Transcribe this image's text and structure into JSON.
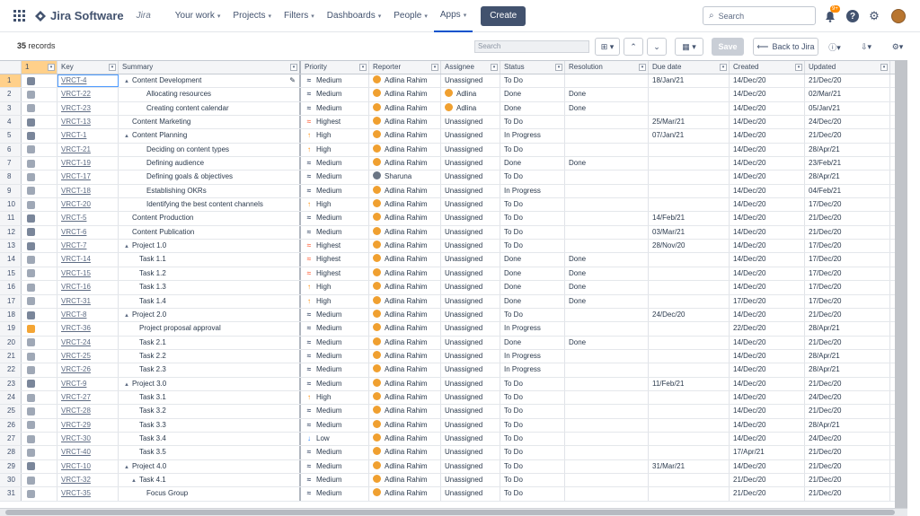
{
  "nav": {
    "app_name": "Jira Software",
    "sub": "Jira",
    "menu": [
      {
        "label": "Your work",
        "dropdown": true
      },
      {
        "label": "Projects",
        "dropdown": true
      },
      {
        "label": "Filters",
        "dropdown": true
      },
      {
        "label": "Dashboards",
        "dropdown": true
      },
      {
        "label": "People",
        "dropdown": true
      },
      {
        "label": "Apps",
        "dropdown": true,
        "active": true
      }
    ],
    "create": "Create",
    "search_placeholder": "Search",
    "notification_count": "9+"
  },
  "toolbar": {
    "records_count": "35",
    "records_label": "records",
    "search_placeholder": "Search",
    "save": "Save",
    "back": "Back to Jira"
  },
  "columns": [
    "",
    "Key",
    "Summary",
    "Priority",
    "Reporter",
    "Assignee",
    "Status",
    "Resolution",
    "Due date",
    "Created",
    "Updated"
  ],
  "rows": [
    {
      "n": "1",
      "type": "epic",
      "key": "VRCT-4",
      "indent": 0,
      "tri": true,
      "summary": "Content Development",
      "pri": "Medium",
      "reporter": "Adlina Rahim",
      "assignee": "Unassigned",
      "status": "To Do",
      "resolution": "",
      "due": "18/Jan/21",
      "created": "14/Dec/20",
      "updated": "21/Dec/20"
    },
    {
      "n": "2",
      "type": "task",
      "key": "VRCT-22",
      "indent": 2,
      "tri": false,
      "summary": "Allocating resources",
      "pri": "Medium",
      "reporter": "Adlina Rahim",
      "assignee": "Adlina",
      "assignee_av": true,
      "status": "Done",
      "resolution": "Done",
      "due": "",
      "created": "14/Dec/20",
      "updated": "02/Mar/21"
    },
    {
      "n": "3",
      "type": "task",
      "key": "VRCT-23",
      "indent": 2,
      "tri": false,
      "summary": "Creating content calendar",
      "pri": "Medium",
      "reporter": "Adlina Rahim",
      "assignee": "Adlina",
      "assignee_av": true,
      "status": "Done",
      "resolution": "Done",
      "due": "",
      "created": "14/Dec/20",
      "updated": "05/Jan/21"
    },
    {
      "n": "4",
      "type": "epic",
      "key": "VRCT-13",
      "indent": 0,
      "tri": false,
      "summary": "Content Marketing",
      "pri": "Highest",
      "reporter": "Adlina Rahim",
      "assignee": "Unassigned",
      "status": "To Do",
      "resolution": "",
      "due": "25/Mar/21",
      "created": "14/Dec/20",
      "updated": "24/Dec/20"
    },
    {
      "n": "5",
      "type": "epic",
      "key": "VRCT-1",
      "indent": 0,
      "tri": true,
      "summary": "Content Planning",
      "pri": "High",
      "reporter": "Adlina Rahim",
      "assignee": "Unassigned",
      "status": "In Progress",
      "resolution": "",
      "due": "07/Jan/21",
      "created": "14/Dec/20",
      "updated": "21/Dec/20"
    },
    {
      "n": "6",
      "type": "task",
      "key": "VRCT-21",
      "indent": 2,
      "tri": false,
      "summary": "Deciding on content types",
      "pri": "High",
      "reporter": "Adlina Rahim",
      "assignee": "Unassigned",
      "status": "To Do",
      "resolution": "",
      "due": "",
      "created": "14/Dec/20",
      "updated": "28/Apr/21"
    },
    {
      "n": "7",
      "type": "task",
      "key": "VRCT-19",
      "indent": 2,
      "tri": false,
      "summary": "Defining audience",
      "pri": "Medium",
      "reporter": "Adlina Rahim",
      "assignee": "Unassigned",
      "status": "Done",
      "resolution": "Done",
      "due": "",
      "created": "14/Dec/20",
      "updated": "23/Feb/21"
    },
    {
      "n": "8",
      "type": "task",
      "key": "VRCT-17",
      "indent": 2,
      "tri": false,
      "summary": "Defining goals & objectives",
      "pri": "Medium",
      "reporter": "Sharuna",
      "reporter_grey": true,
      "assignee": "Unassigned",
      "status": "To Do",
      "resolution": "",
      "due": "",
      "created": "14/Dec/20",
      "updated": "28/Apr/21"
    },
    {
      "n": "9",
      "type": "task",
      "key": "VRCT-18",
      "indent": 2,
      "tri": false,
      "summary": "Establishing OKRs",
      "pri": "Medium",
      "reporter": "Adlina Rahim",
      "assignee": "Unassigned",
      "status": "In Progress",
      "resolution": "",
      "due": "",
      "created": "14/Dec/20",
      "updated": "04/Feb/21"
    },
    {
      "n": "10",
      "type": "task",
      "key": "VRCT-20",
      "indent": 2,
      "tri": false,
      "summary": "Identifying the best content channels",
      "pri": "High",
      "reporter": "Adlina Rahim",
      "assignee": "Unassigned",
      "status": "To Do",
      "resolution": "",
      "due": "",
      "created": "14/Dec/20",
      "updated": "17/Dec/20"
    },
    {
      "n": "11",
      "type": "epic",
      "key": "VRCT-5",
      "indent": 0,
      "tri": false,
      "summary": "Content Production",
      "pri": "Medium",
      "reporter": "Adlina Rahim",
      "assignee": "Unassigned",
      "status": "To Do",
      "resolution": "",
      "due": "14/Feb/21",
      "created": "14/Dec/20",
      "updated": "21/Dec/20"
    },
    {
      "n": "12",
      "type": "epic",
      "key": "VRCT-6",
      "indent": 0,
      "tri": false,
      "summary": "Content Publication",
      "pri": "Medium",
      "reporter": "Adlina Rahim",
      "assignee": "Unassigned",
      "status": "To Do",
      "resolution": "",
      "due": "03/Mar/21",
      "created": "14/Dec/20",
      "updated": "21/Dec/20"
    },
    {
      "n": "13",
      "type": "epic",
      "key": "VRCT-7",
      "indent": 0,
      "tri": true,
      "summary": "Project 1.0",
      "pri": "Highest",
      "reporter": "Adlina Rahim",
      "assignee": "Unassigned",
      "status": "To Do",
      "resolution": "",
      "due": "28/Nov/20",
      "created": "14/Dec/20",
      "updated": "17/Dec/20"
    },
    {
      "n": "14",
      "type": "task",
      "key": "VRCT-14",
      "indent": 1,
      "tri": false,
      "summary": "Task 1.1",
      "pri": "Highest",
      "reporter": "Adlina Rahim",
      "assignee": "Unassigned",
      "status": "Done",
      "resolution": "Done",
      "due": "",
      "created": "14/Dec/20",
      "updated": "17/Dec/20"
    },
    {
      "n": "15",
      "type": "task",
      "key": "VRCT-15",
      "indent": 1,
      "tri": false,
      "summary": "Task 1.2",
      "pri": "Highest",
      "reporter": "Adlina Rahim",
      "assignee": "Unassigned",
      "status": "Done",
      "resolution": "Done",
      "due": "",
      "created": "14/Dec/20",
      "updated": "17/Dec/20"
    },
    {
      "n": "16",
      "type": "task",
      "key": "VRCT-16",
      "indent": 1,
      "tri": false,
      "summary": "Task 1.3",
      "pri": "High",
      "reporter": "Adlina Rahim",
      "assignee": "Unassigned",
      "status": "Done",
      "resolution": "Done",
      "due": "",
      "created": "14/Dec/20",
      "updated": "17/Dec/20"
    },
    {
      "n": "17",
      "type": "task",
      "key": "VRCT-31",
      "indent": 1,
      "tri": false,
      "summary": "Task 1.4",
      "pri": "High",
      "reporter": "Adlina Rahim",
      "assignee": "Unassigned",
      "status": "Done",
      "resolution": "Done",
      "due": "",
      "created": "17/Dec/20",
      "updated": "17/Dec/20"
    },
    {
      "n": "18",
      "type": "epic",
      "key": "VRCT-8",
      "indent": 0,
      "tri": true,
      "summary": "Project 2.0",
      "pri": "Medium",
      "reporter": "Adlina Rahim",
      "assignee": "Unassigned",
      "status": "To Do",
      "resolution": "",
      "due": "24/Dec/20",
      "created": "14/Dec/20",
      "updated": "21/Dec/20"
    },
    {
      "n": "19",
      "type": "story",
      "key": "VRCT-36",
      "indent": 1,
      "tri": false,
      "summary": "Project proposal approval",
      "pri": "Medium",
      "reporter": "Adlina Rahim",
      "assignee": "Unassigned",
      "status": "In Progress",
      "resolution": "",
      "due": "",
      "created": "22/Dec/20",
      "updated": "28/Apr/21"
    },
    {
      "n": "20",
      "type": "task",
      "key": "VRCT-24",
      "indent": 1,
      "tri": false,
      "summary": "Task 2.1",
      "pri": "Medium",
      "reporter": "Adlina Rahim",
      "assignee": "Unassigned",
      "status": "Done",
      "resolution": "Done",
      "due": "",
      "created": "14/Dec/20",
      "updated": "21/Dec/20"
    },
    {
      "n": "21",
      "type": "task",
      "key": "VRCT-25",
      "indent": 1,
      "tri": false,
      "summary": "Task 2.2",
      "pri": "Medium",
      "reporter": "Adlina Rahim",
      "assignee": "Unassigned",
      "status": "In Progress",
      "resolution": "",
      "due": "",
      "created": "14/Dec/20",
      "updated": "28/Apr/21"
    },
    {
      "n": "22",
      "type": "task",
      "key": "VRCT-26",
      "indent": 1,
      "tri": false,
      "summary": "Task 2.3",
      "pri": "Medium",
      "reporter": "Adlina Rahim",
      "assignee": "Unassigned",
      "status": "In Progress",
      "resolution": "",
      "due": "",
      "created": "14/Dec/20",
      "updated": "28/Apr/21"
    },
    {
      "n": "23",
      "type": "epic",
      "key": "VRCT-9",
      "indent": 0,
      "tri": true,
      "summary": "Project 3.0",
      "pri": "Medium",
      "reporter": "Adlina Rahim",
      "assignee": "Unassigned",
      "status": "To Do",
      "resolution": "",
      "due": "11/Feb/21",
      "created": "14/Dec/20",
      "updated": "21/Dec/20"
    },
    {
      "n": "24",
      "type": "task",
      "key": "VRCT-27",
      "indent": 1,
      "tri": false,
      "summary": "Task 3.1",
      "pri": "High",
      "reporter": "Adlina Rahim",
      "assignee": "Unassigned",
      "status": "To Do",
      "resolution": "",
      "due": "",
      "created": "14/Dec/20",
      "updated": "24/Dec/20"
    },
    {
      "n": "25",
      "type": "task",
      "key": "VRCT-28",
      "indent": 1,
      "tri": false,
      "summary": "Task 3.2",
      "pri": "Medium",
      "reporter": "Adlina Rahim",
      "assignee": "Unassigned",
      "status": "To Do",
      "resolution": "",
      "due": "",
      "created": "14/Dec/20",
      "updated": "21/Dec/20"
    },
    {
      "n": "26",
      "type": "task",
      "key": "VRCT-29",
      "indent": 1,
      "tri": false,
      "summary": "Task 3.3",
      "pri": "Medium",
      "reporter": "Adlina Rahim",
      "assignee": "Unassigned",
      "status": "To Do",
      "resolution": "",
      "due": "",
      "created": "14/Dec/20",
      "updated": "28/Apr/21"
    },
    {
      "n": "27",
      "type": "task",
      "key": "VRCT-30",
      "indent": 1,
      "tri": false,
      "summary": "Task 3.4",
      "pri": "Low",
      "reporter": "Adlina Rahim",
      "assignee": "Unassigned",
      "status": "To Do",
      "resolution": "",
      "due": "",
      "created": "14/Dec/20",
      "updated": "24/Dec/20"
    },
    {
      "n": "28",
      "type": "task",
      "key": "VRCT-40",
      "indent": 1,
      "tri": false,
      "summary": "Task 3.5",
      "pri": "Medium",
      "reporter": "Adlina Rahim",
      "assignee": "Unassigned",
      "status": "To Do",
      "resolution": "",
      "due": "",
      "created": "17/Apr/21",
      "updated": "21/Dec/20"
    },
    {
      "n": "29",
      "type": "epic",
      "key": "VRCT-10",
      "indent": 0,
      "tri": true,
      "summary": "Project 4.0",
      "pri": "Medium",
      "reporter": "Adlina Rahim",
      "assignee": "Unassigned",
      "status": "To Do",
      "resolution": "",
      "due": "31/Mar/21",
      "created": "14/Dec/20",
      "updated": "21/Dec/20"
    },
    {
      "n": "30",
      "type": "task",
      "key": "VRCT-32",
      "indent": 1,
      "tri": true,
      "summary": "Task 4.1",
      "pri": "Medium",
      "reporter": "Adlina Rahim",
      "assignee": "Unassigned",
      "status": "To Do",
      "resolution": "",
      "due": "",
      "created": "21/Dec/20",
      "updated": "21/Dec/20"
    },
    {
      "n": "31",
      "type": "task",
      "key": "VRCT-35",
      "indent": 2,
      "tri": false,
      "summary": "Focus Group",
      "pri": "Medium",
      "reporter": "Adlina Rahim",
      "assignee": "Unassigned",
      "status": "To Do",
      "resolution": "",
      "due": "",
      "created": "21/Dec/20",
      "updated": "21/Dec/20"
    }
  ],
  "colors": {
    "highest": "#ff7452",
    "high": "#ff8b00",
    "medium": "#42526e",
    "low": "#2684ff",
    "avatar": "#f0a030"
  }
}
